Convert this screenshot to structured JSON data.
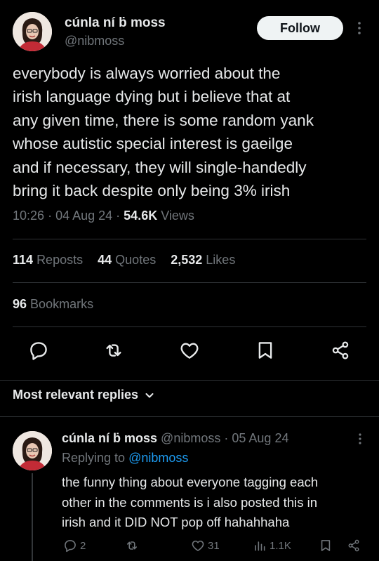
{
  "author": {
    "name": "cúnla ní ḃ moss",
    "handle": "@nibmoss",
    "follow_label": "Follow"
  },
  "tweet": {
    "lines": [
      "everybody is always worried about the",
      "irish language dying but i believe that at",
      "any given time, there is some random yank",
      "whose autistic special interest is gaeilge",
      "and if necessary, they will single-handedly",
      "bring it back despite only being 3% irish"
    ],
    "time": "10:26",
    "date": "04 Aug 24",
    "views_count": "54.6K",
    "views_label": "Views"
  },
  "stats": {
    "reposts_count": "114",
    "reposts_label": "Reposts",
    "quotes_count": "44",
    "quotes_label": "Quotes",
    "likes_count": "2,532",
    "likes_label": "Likes",
    "bookmarks_count": "96",
    "bookmarks_label": "Bookmarks"
  },
  "action_icons": [
    "reply-icon",
    "repost-icon",
    "like-icon",
    "bookmark-icon",
    "share-icon"
  ],
  "replies_sort": {
    "label": "Most relevant replies"
  },
  "reply": {
    "name": "cúnla ní ḃ moss",
    "handle": "@nibmoss",
    "date": "05 Aug 24",
    "replying_prefix": "Replying to",
    "replying_mention": "@nibmoss",
    "lines": [
      "the funny thing about everyone tagging each",
      "other in the comments is i also posted this in",
      "irish and it DID NOT pop off hahahhaha"
    ],
    "replies_count": "2",
    "likes_count": "31",
    "views_count": "1.1K"
  },
  "colors": {
    "background": "#000000",
    "text": "#e7e9ea",
    "muted": "#71767b",
    "link": "#1d9bf0",
    "divider": "#2f3336"
  }
}
